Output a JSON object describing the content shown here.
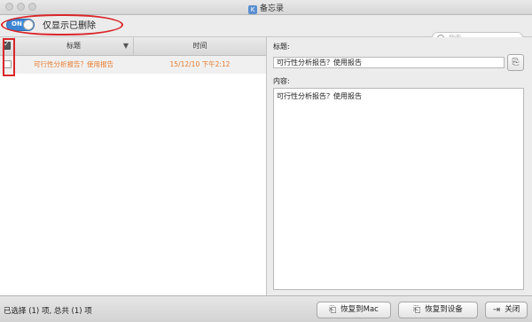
{
  "window": {
    "title": "备忘录",
    "app_icon": "K"
  },
  "toolbar": {
    "toggle_state": "ON",
    "toggle_label": "仅显示已删除",
    "search_placeholder": "搜索"
  },
  "table": {
    "columns": {
      "title": "标题",
      "time": "时间",
      "sort_indicator": "▼"
    },
    "rows": [
      {
        "title": "可行性分析报告？使用报告",
        "time": "15/12/10 下午2:12",
        "checked": false
      }
    ]
  },
  "detail": {
    "title_label": "标题:",
    "title_value": "可行性分析报告？使用报告",
    "content_label": "内容:",
    "content_value": "可行性分析报告？使用报告"
  },
  "status": {
    "text": "已选择 (1) 项, 总共 (1) 项"
  },
  "buttons": {
    "restore_mac": "恢复到Mac",
    "restore_device": "恢复到设备",
    "close": "关闭"
  },
  "colors": {
    "accent": "#3c86d4",
    "highlight_red": "#d9262a",
    "row_text": "#e8792a"
  },
  "icons": {
    "restore_mac": "restore-icon",
    "restore_device": "restore-icon",
    "close": "exit-icon",
    "copy": "copy-icon"
  }
}
